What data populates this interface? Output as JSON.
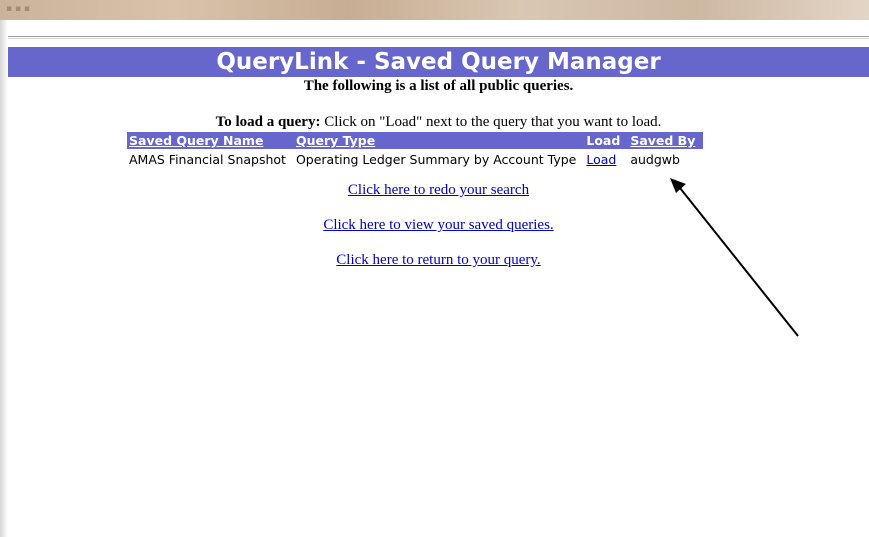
{
  "banner": {
    "title": "QueryLink - Saved Query Manager"
  },
  "subtitle": "The following is a list of all public queries.",
  "instructions": {
    "bold": "To load a query:",
    "text": " Click on \"Load\" next to the query that you want to load."
  },
  "table": {
    "headers": [
      "Saved Query Name",
      "Query Type",
      "Load",
      "Saved By"
    ],
    "rows": [
      {
        "name": "AMAS Financial Snapshot",
        "type": "Operating Ledger Summary by Account Type",
        "load": "Load",
        "saved_by": "audgwb"
      }
    ]
  },
  "links": {
    "redo": "Click here to redo your search",
    "view_saved": "Click here to view your saved queries.",
    "return": "Click here to return to your query."
  },
  "colors": {
    "accent": "#6666cc",
    "link": "#0000cc",
    "annotation_arrow": "#000000"
  }
}
